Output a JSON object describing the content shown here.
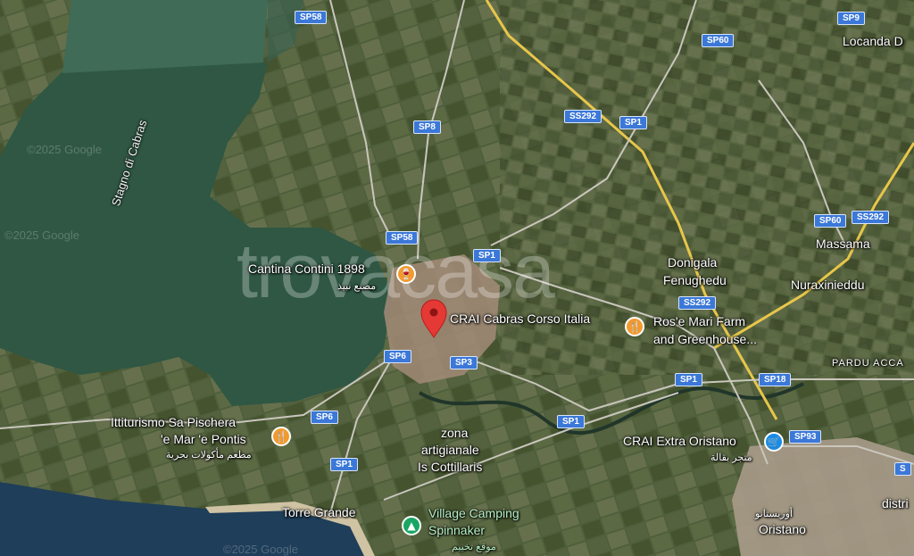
{
  "water_label": "Stagno di Cabras",
  "watermarks": {
    "copyright": "©2025 Google",
    "google": "©2025 Google",
    "google2": "©2025 Google",
    "brand": "trovacasa"
  },
  "place_labels": {
    "locanda": "Locanda D",
    "massama": "Massama",
    "nuraxinieddu": "Nuraxinieddu",
    "donigala": "Donigala",
    "fenughedu": "Fenughedu",
    "pardu": "PARDU ACCA",
    "zona": "zona",
    "artigianale": "artigianale",
    "cottillaris": "Is Cottillaris",
    "torre_grande": "Torre Grande",
    "oristano": "Oristano",
    "oristano_ar": "أوريستانو",
    "distri": "distri"
  },
  "roads": {
    "sp58_top": "SP58",
    "sp9": "SP9",
    "sp60_top": "SP60",
    "ss292_top": "SS292",
    "sp1_top": "SP1",
    "sp8": "SP8",
    "sp60_right": "SP60",
    "ss292_right": "SS292",
    "sp58_mid": "SP58",
    "sp1_mid": "SP1",
    "ss292_mid": "SS292",
    "sp6_a": "SP6",
    "sp3": "SP3",
    "sp1_right": "SP1",
    "sp18": "SP18",
    "sp6_b": "SP6",
    "sp1_c": "SP1",
    "sp93": "SP93",
    "sp1_low": "SP1",
    "sp_edge": "S"
  },
  "pois": {
    "cantina": {
      "name": "Cantina Contini 1898",
      "sub": "مصنع نبيذ",
      "icon": "wine-glass-icon"
    },
    "crai_cabras": {
      "name": "CRAI Cabras Corso Italia",
      "icon": "map-pin-icon"
    },
    "rose_mari": {
      "name": "Ros'e Mari Farm",
      "name2": "and Greenhouse...",
      "icon": "restaurant-icon"
    },
    "ittiturismo": {
      "name": "Ittiturismo Sa Pischera",
      "name2": "'e Mar 'e Pontis",
      "sub": "مطعم مأكولات بحرية",
      "icon": "restaurant-icon"
    },
    "crai_extra": {
      "name": "CRAI Extra Oristano",
      "sub": "متجر بقالة",
      "icon": "shopping-cart-icon"
    },
    "camping": {
      "name": "Village Camping",
      "name2": "Spinnaker",
      "sub": "موقع تخييم",
      "icon": "campsite-icon"
    }
  },
  "colors": {
    "road_shield": "#3b78d8",
    "marker_red": "#e53935",
    "poi_orange": "#f29a2e",
    "poi_blue": "#1a8be6",
    "poi_green": "#19a664"
  }
}
